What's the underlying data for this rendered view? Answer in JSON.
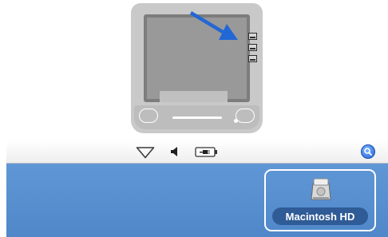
{
  "illustration": {
    "monitor_icon": "imac-icon",
    "pointer_icon": "arrow-icon",
    "drive_icons": [
      "drive-icon",
      "drive-icon",
      "drive-icon"
    ]
  },
  "menubar": {
    "icons": [
      "wifi-icon",
      "volume-icon",
      "battery-icon",
      "spotlight-icon"
    ]
  },
  "desktop": {
    "items": [
      {
        "label": "Macintosh HD",
        "icon": "hard-drive-icon",
        "selected": true
      }
    ]
  },
  "colors": {
    "desktop": "#5f97d6",
    "selection_outline": "#ffffff",
    "label_highlight": "#2f5b96",
    "arrow": "#2367d4",
    "spotlight": "#1f62d8"
  }
}
